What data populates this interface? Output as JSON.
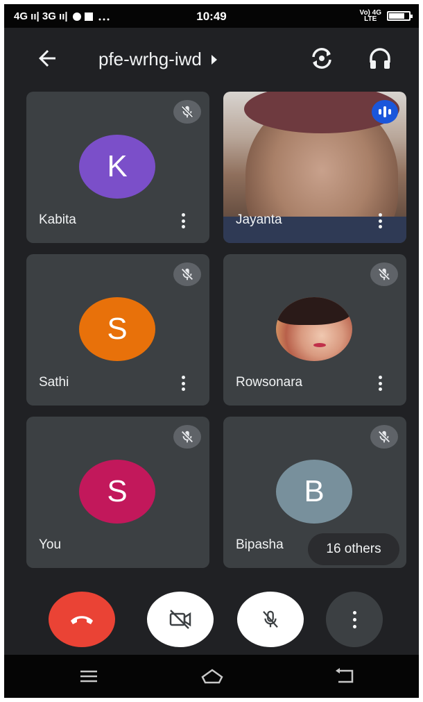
{
  "status_bar": {
    "left_text": "4G ıı| 3G ıı|",
    "time": "10:49",
    "network": "Vo) 4G\nLTE"
  },
  "meeting": {
    "title": "pfe-wrhg-iwd"
  },
  "participants": [
    {
      "name": "Kabita",
      "initial": "K",
      "avatar_color": "#7b4fc9",
      "muted": true
    },
    {
      "name": "Jayanta",
      "video": true,
      "speaking": true
    },
    {
      "name": "Sathi",
      "initial": "S",
      "avatar_color": "#e8710a",
      "muted": true
    },
    {
      "name": "Rowsonara",
      "photo": true,
      "muted": true
    },
    {
      "name": "You",
      "initial": "S",
      "avatar_color": "#c2185b",
      "muted": true
    },
    {
      "name": "Bipasha",
      "initial": "B",
      "avatar_color": "#78909c",
      "muted": true
    }
  ],
  "others_chip": "16 others",
  "icons": {
    "back": "arrow-back-icon",
    "flip": "switch-camera-icon",
    "audio": "headphones-icon",
    "mute": "mic-off-icon",
    "end_call": "phone-hangup-icon",
    "camera": "videocam-off-icon",
    "mic": "mic-off-icon",
    "more": "more-vert-icon"
  }
}
